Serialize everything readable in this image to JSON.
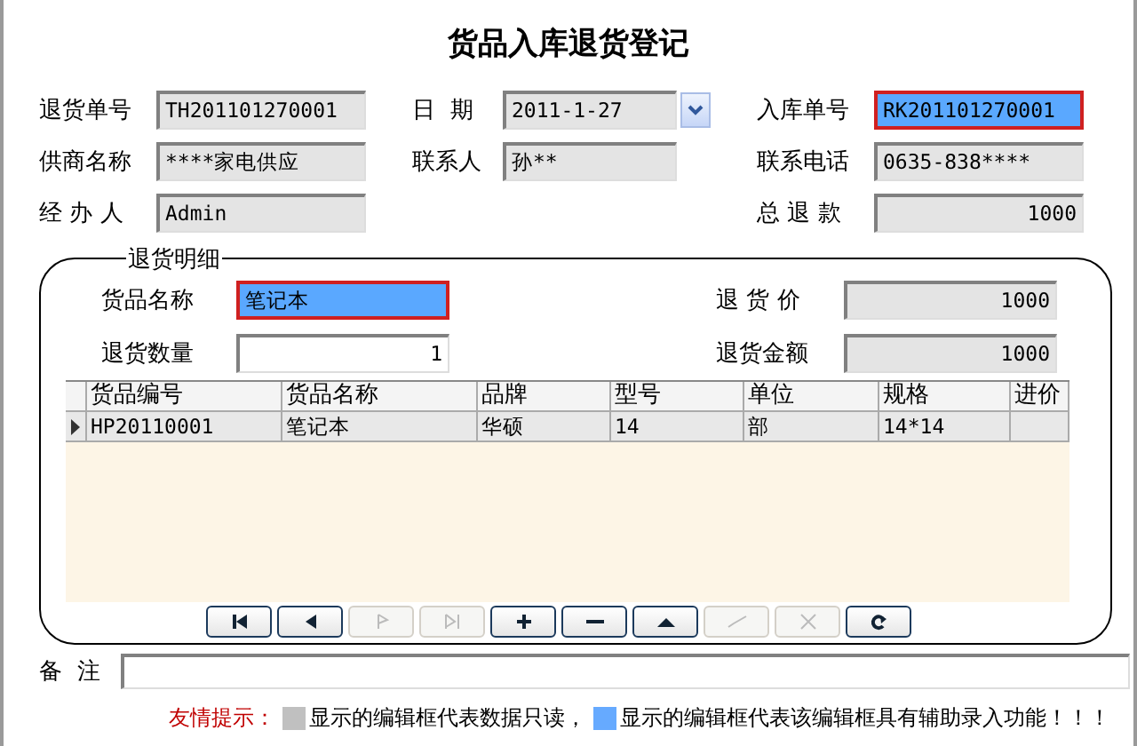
{
  "title": "货品入库退货登记",
  "rows": [
    {
      "left": {
        "label": "退货单号",
        "value": "TH201101270001",
        "kind": "readonly"
      },
      "middle": {
        "label": "日  期",
        "value": "2011-1-27",
        "kind": "combo"
      },
      "right": {
        "label": "入库单号",
        "value": "RK201101270001",
        "kind": "assist"
      }
    },
    {
      "left": {
        "label": "供商名称",
        "value": "****家电供应",
        "kind": "readonly"
      },
      "middle": {
        "label": "联系人",
        "value": "孙**",
        "kind": "readonly"
      },
      "right": {
        "label": "联系电话",
        "value": "0635-838****",
        "kind": "readonly"
      }
    },
    {
      "left": {
        "label": "经 办 人",
        "value": "Admin",
        "kind": "readonly"
      },
      "right": {
        "label": "总 退 款",
        "value": "1000",
        "kind": "readonly-number"
      }
    }
  ],
  "detail": {
    "legend": "退货明细",
    "rows": [
      {
        "left": {
          "label": "货品名称",
          "value": "笔记本",
          "kind": "assist"
        },
        "right": {
          "label": "退 货 价",
          "value": "1000",
          "kind": "readonly-number"
        }
      },
      {
        "left": {
          "label": "退货数量",
          "value": "1",
          "kind": "number"
        },
        "right": {
          "label": "退货金额",
          "value": "1000",
          "kind": "readonly-number"
        }
      }
    ],
    "table": {
      "columns": [
        "货品编号",
        "货品名称",
        "品牌",
        "型号",
        "单位",
        "规格",
        "进价"
      ],
      "rows": [
        {
          "current": true,
          "cells": [
            "HP20110001",
            "笔记本",
            "华硕",
            "14",
            "部",
            "14*14"
          ]
        }
      ]
    },
    "navigator": [
      {
        "kind": "first",
        "disabled": false
      },
      {
        "kind": "prior",
        "disabled": false
      },
      {
        "kind": "next",
        "disabled": true
      },
      {
        "kind": "last",
        "disabled": true
      },
      {
        "kind": "insert",
        "disabled": false
      },
      {
        "kind": "delete",
        "disabled": false
      },
      {
        "kind": "edit",
        "disabled": false
      },
      {
        "kind": "post",
        "disabled": true
      },
      {
        "kind": "cancel",
        "disabled": true
      },
      {
        "kind": "refresh",
        "disabled": false
      }
    ]
  },
  "remark": {
    "label": "备  注"
  },
  "hint": {
    "title": "友情提示：",
    "items": [
      {
        "color": "#c0c0c0",
        "text": "显示的编辑框代表数据只读，"
      },
      {
        "color": "#66aaff",
        "text": "显示的编辑框代表该编辑框具有辅助录入功能！！！"
      }
    ]
  }
}
